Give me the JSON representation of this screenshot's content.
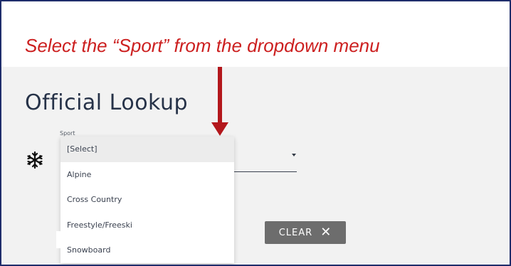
{
  "instruction": "Select the “Sport” from the dropdown menu",
  "page_title": "Official Lookup",
  "sport_field": {
    "label": "Sport",
    "selected": "[Select]",
    "options": [
      "[Select]",
      "Alpine",
      "Cross Country",
      "Freestyle/Freeski",
      "Snowboard"
    ]
  },
  "clear_button": {
    "label": "CLEAR",
    "icon": "close-icon"
  },
  "icons": {
    "sport": "snowflake-icon",
    "arrow": "down-arrow-icon"
  },
  "colors": {
    "annotation": "#cc1f1f",
    "title": "#263248",
    "button": "#6d6d6d",
    "frame": "#1f2d6b"
  }
}
